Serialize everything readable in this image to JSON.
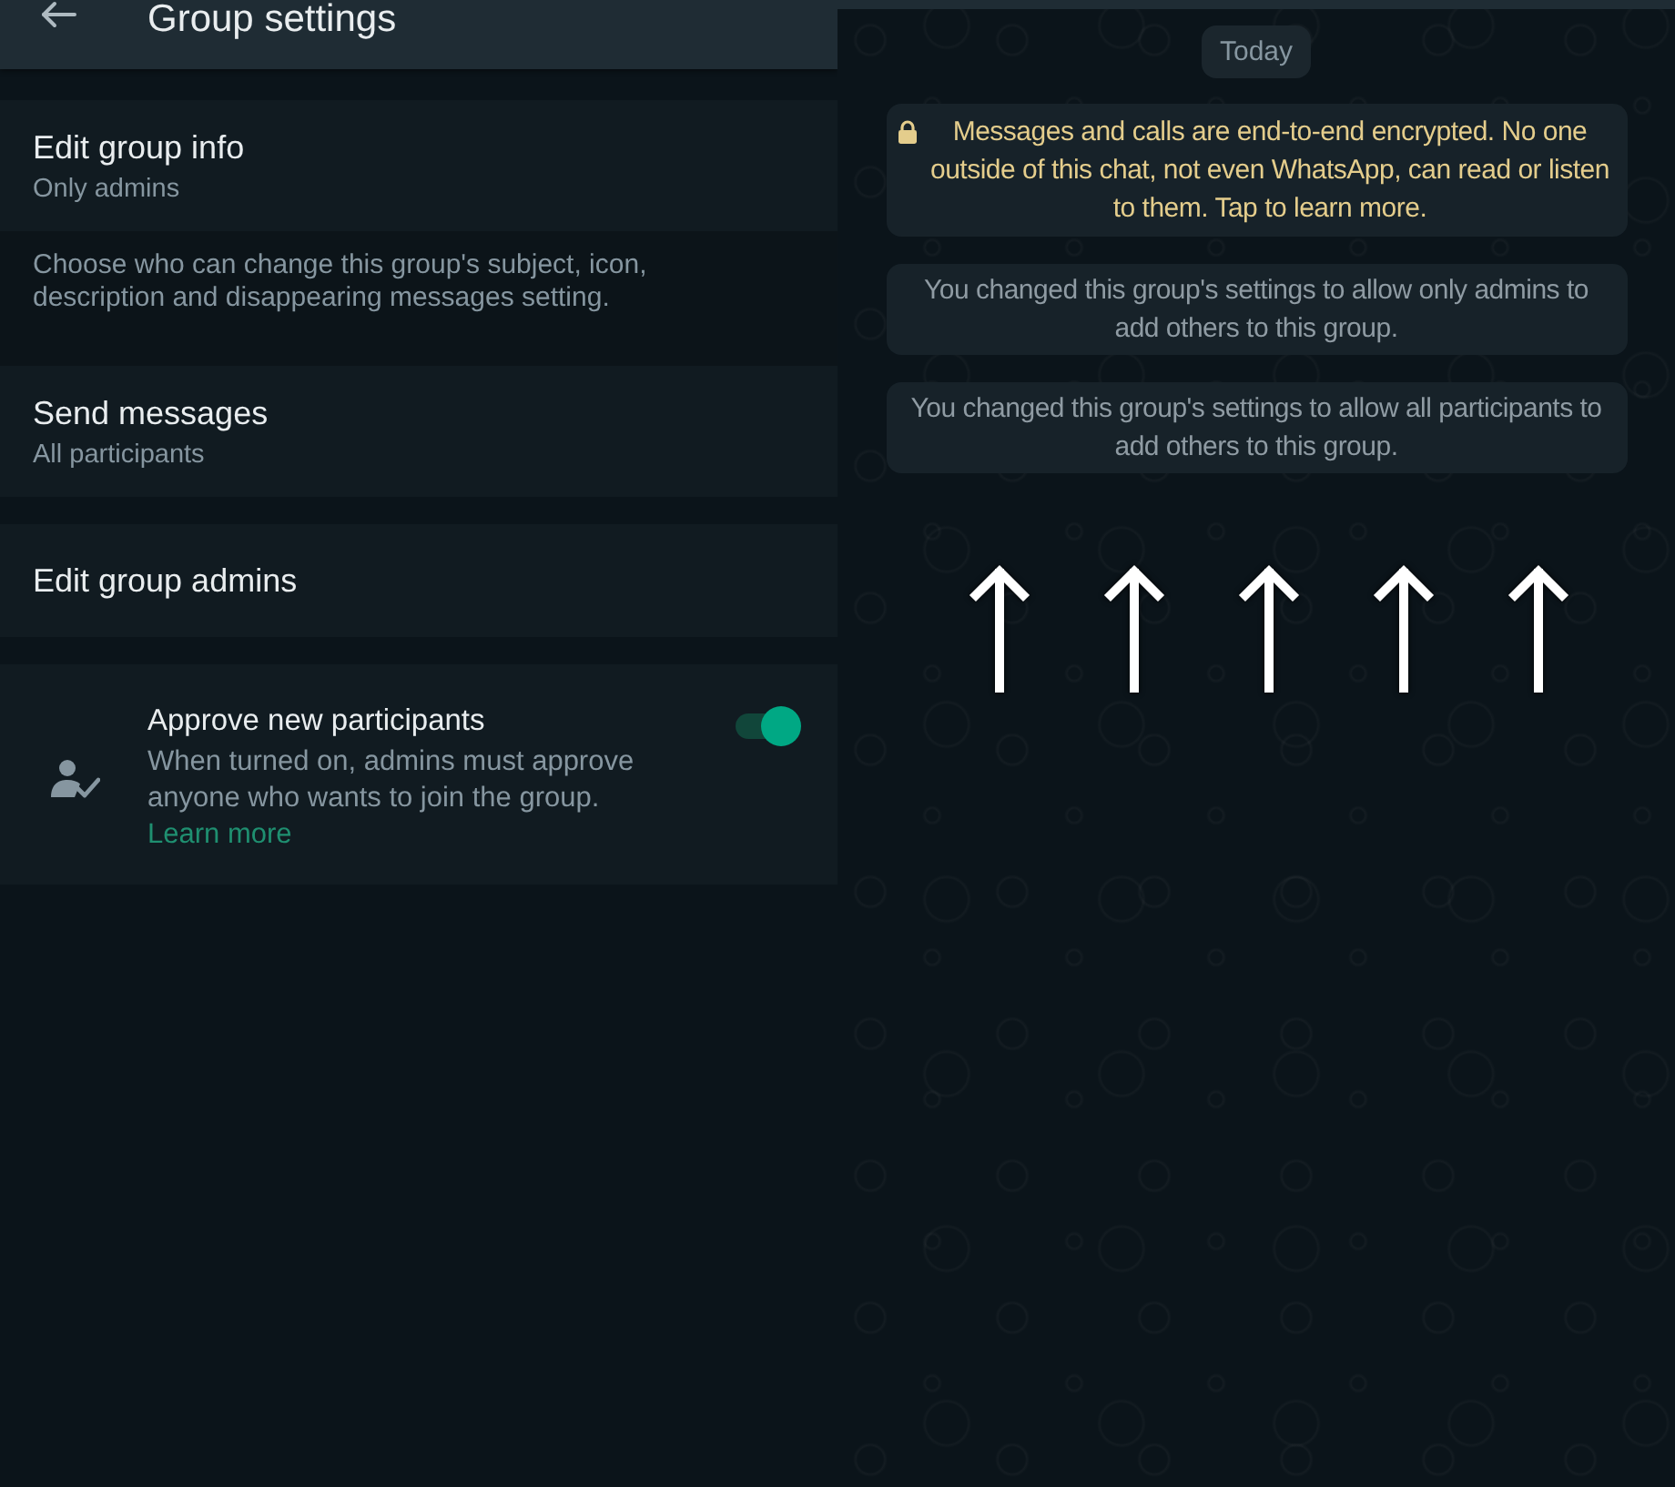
{
  "header": {
    "title": "Group settings"
  },
  "settings": [
    {
      "kind": "option",
      "title": "Edit group info",
      "value": "Only admins"
    },
    {
      "kind": "note",
      "text": "Choose who can change this group's subject, icon, description and disappearing messages setting."
    },
    {
      "kind": "option",
      "title": "Send messages",
      "value": "All participants"
    },
    {
      "kind": "option",
      "title": "Edit group admins"
    },
    {
      "kind": "toggle",
      "title": "Approve new participants",
      "description": "When turned on, admins must approve anyone who wants to join the group.",
      "link": "Learn more",
      "on": true
    }
  ],
  "chat": {
    "date_chip": "Today",
    "messages": [
      {
        "kind": "encryption",
        "text": "Messages and calls are end-to-end encrypted. No one outside of this chat, not even WhatsApp, can read or listen to them. Tap to learn more."
      },
      {
        "kind": "system",
        "text": "You changed this group's settings to allow only admins to add others to this group."
      },
      {
        "kind": "system",
        "text": "You changed this group's settings to allow all participants to add others to this group."
      }
    ]
  },
  "annotation_arrows": [
    {
      "kind": "arrow"
    },
    {
      "kind": "arrow"
    },
    {
      "kind": "arrow"
    },
    {
      "kind": "arrow"
    },
    {
      "kind": "arrow"
    }
  ]
}
